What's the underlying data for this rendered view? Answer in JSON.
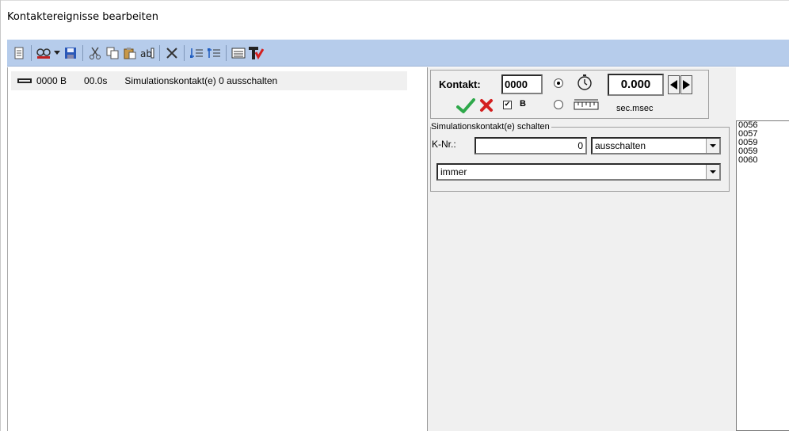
{
  "window": {
    "title": "Kontaktereignisse bearbeiten"
  },
  "toolbar": {
    "buttons": [
      {
        "icon": "new-document-icon"
      },
      {
        "icon": "find-icon"
      },
      {
        "icon": "save-icon"
      },
      {
        "icon": "cut-icon"
      },
      {
        "icon": "copy-icon"
      },
      {
        "icon": "paste-icon"
      },
      {
        "icon": "rename-icon"
      },
      {
        "icon": "delete-icon"
      },
      {
        "icon": "move-down-icon"
      },
      {
        "icon": "move-up-icon"
      },
      {
        "icon": "list-view-icon"
      },
      {
        "icon": "red-t-icon"
      }
    ]
  },
  "events": [
    {
      "id": "0000 B",
      "time": "00.0s",
      "description": "Simulationskontakt(e) 0 ausschalten"
    }
  ],
  "editor": {
    "kontakt_label": "Kontakt:",
    "kontakt_value": "0000",
    "b_label": "B",
    "time_value": "0.000",
    "unit_label": "sec.msec",
    "group_label": "Simulationskontakt(e) schalten",
    "knr_label": "K-Nr.:",
    "knr_value": "0",
    "action_value": "ausschalten",
    "condition_value": "immer",
    "radio_timer_selected": true,
    "b_checked": true
  },
  "contact_list": [
    "0056",
    "0057",
    "0059",
    "0059",
    "0060"
  ],
  "colors": {
    "toolbar_bg": "#b6cceb",
    "ok_green": "#2ea84a",
    "cancel_red": "#d42020"
  }
}
